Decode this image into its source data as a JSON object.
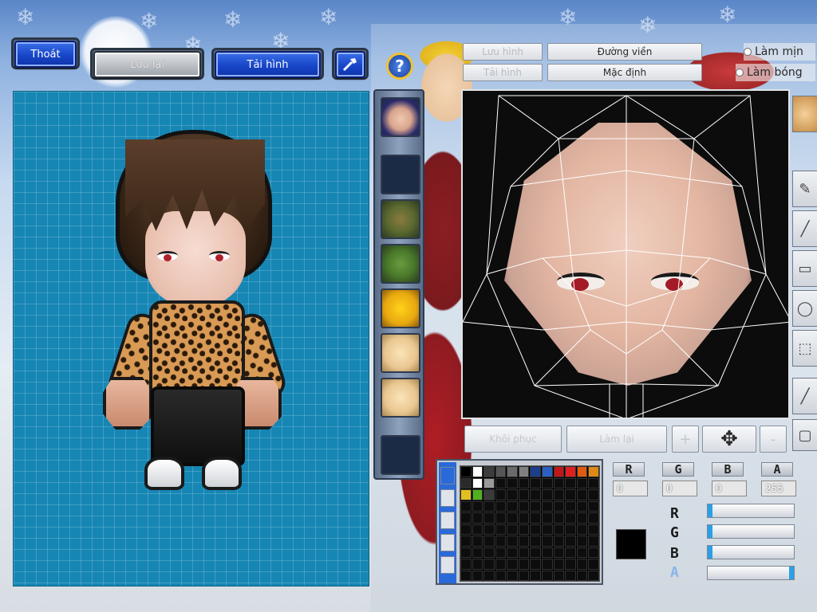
{
  "top_buttons": {
    "exit": "Thoát",
    "save": "Lưu lại",
    "reload": "Tải hình"
  },
  "help_icon_glyph": "?",
  "toolbar": {
    "save_image": "Lưu hình",
    "load_image": "Tải hình",
    "outline": "Đường viền",
    "default": "Mặc định",
    "smooth_option": "Làm mịn",
    "shade_option": "Làm bóng"
  },
  "bottom_controls": {
    "restore": "Khôi phục",
    "redo": "Làm lại",
    "plus": "+",
    "minus": "-"
  },
  "color": {
    "r_label": "R",
    "g_label": "G",
    "b_label": "B",
    "a_label": "A",
    "r_value": "0",
    "g_value": "0",
    "b_value": "0",
    "a_value": "255",
    "current_hex": "#000000",
    "slider_levels": {
      "r": 0,
      "g": 0,
      "b": 0,
      "a": 1
    }
  },
  "palette_top_row": [
    "#000000",
    "#ffffff",
    "#3c3c3c",
    "#555555",
    "#6a6a6a",
    "#808080",
    "#1c3f8c",
    "#2a60c0",
    "#c01818",
    "#e02020",
    "#e05a10",
    "#e08818"
  ],
  "palette_second_row": [
    "#2a2a2a",
    "#ffffff",
    "#9a9a9a"
  ],
  "palette_third_row": [
    "#e0c020",
    "#50b020",
    "#3a3a3a"
  ],
  "thumbnails": [
    "face-portrait",
    "blank",
    "beast-head",
    "green-jacket",
    "yellow-face",
    "skin-face-1",
    "skin-face-2",
    "blank"
  ],
  "tools": [
    "pen-icon",
    "line-icon",
    "rect-icon",
    "ellipse-icon",
    "select-icon",
    "eyedropper-icon",
    "eraser-icon"
  ]
}
